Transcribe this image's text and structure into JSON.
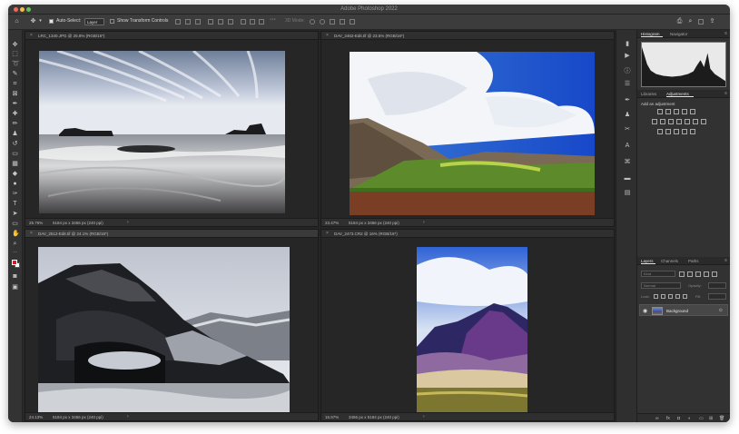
{
  "window": {
    "title": "Adobe Photoshop 2022"
  },
  "options_bar": {
    "auto_select_label": "Auto-Select:",
    "auto_select_value": "Layer",
    "show_transform_label": "Show Transform Controls",
    "three_d_mode_label": "3D Mode:"
  },
  "documents": [
    {
      "tab": "LRC_1340.JPG @ 25.8% (RGB/15*)",
      "zoom": "25.76%",
      "dims": "5184 px x 3456 px (240 ppi)",
      "active": false
    },
    {
      "tab": "DAV_2462-Edit.tif @ 23.5% (RGB/16*)",
      "zoom": "23.47%",
      "dims": "5184 px x 3456 px (240 ppi)",
      "active": false
    },
    {
      "tab": "DAV_2512-Edit.tif @ 24.1% (RGB/16*)",
      "zoom": "24.13%",
      "dims": "5184 px x 3456 px (240 ppi)",
      "active": true
    },
    {
      "tab": "DAV_2473.CR2 @ 16% (RGB/16*)",
      "zoom": "15.97%",
      "dims": "3456 px x 5184 px (240 ppi)",
      "active": false
    }
  ],
  "panels": {
    "histogram_tabs": [
      "Histogram",
      "Navigator"
    ],
    "adjust_tabs": [
      "Libraries",
      "Adjustments"
    ],
    "adjust_title": "Add an adjustment",
    "layers_tabs": [
      "Layers",
      "Channels",
      "Paths"
    ],
    "kind_placeholder": "Kind",
    "blend_mode": "Normal",
    "opacity": "Opacity:",
    "lock_label": "Lock:",
    "fill": "Fill:",
    "layer_name": "Background"
  },
  "colors": {
    "foreground": "#d01e2a",
    "background": "#ffffff",
    "accent": "#e8e8e8"
  }
}
